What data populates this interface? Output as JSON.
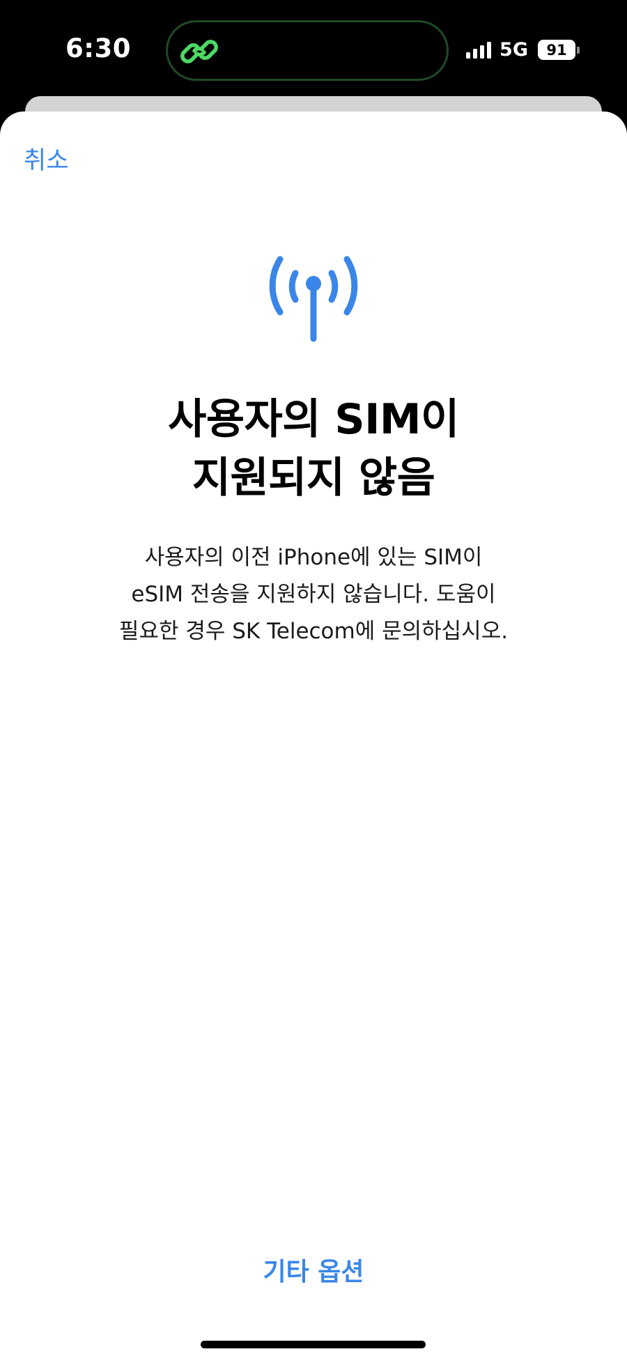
{
  "status_bar": {
    "time": "6:30",
    "network": "5G",
    "battery_percent": "91",
    "signal_bars": 4,
    "island_icon": "link-icon"
  },
  "colors": {
    "accent": "#3a86e8",
    "island_icon": "#4cd964",
    "background": "#ffffff"
  },
  "sheet": {
    "cancel_label": "취소",
    "icon": "antenna-signal-icon",
    "title_line1": "사용자의 SIM이",
    "title_line2": "지원되지 않음",
    "description_line1": "사용자의 이전 iPhone에 있는 SIM이",
    "description_line2": "eSIM 전송을 지원하지 않습니다. 도움이",
    "description_line3": "필요한 경우 SK Telecom에 문의하십시오.",
    "other_options_label": "기타 옵션"
  }
}
